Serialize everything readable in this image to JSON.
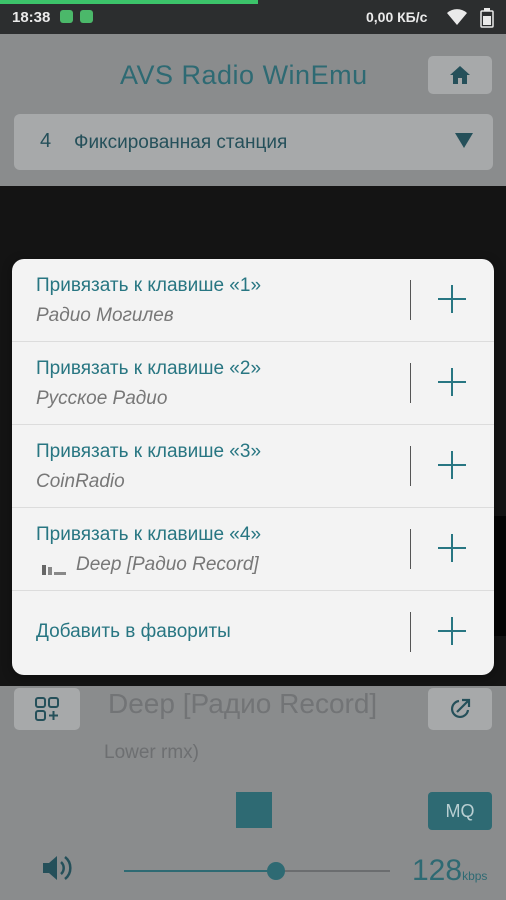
{
  "status_bar": {
    "time": "18:38",
    "network_speed": "0,00 КБ/с",
    "progress": 0.51
  },
  "app": {
    "title": "AVS Radio WinEmu",
    "station": {
      "number": "4",
      "name": "Фиксированная станция"
    },
    "now_playing": {
      "title": "Deep [Радио Record]",
      "subtitle": "Lower rmx)"
    },
    "mq_label": "MQ",
    "bitrate": "128",
    "bitrate_unit": "kbps",
    "volume": 0.57,
    "accent_color": "#2e6a73"
  },
  "dialog": {
    "items": [
      {
        "label": "Привязать к клавише «1»",
        "subtitle": "Радио Могилев"
      },
      {
        "label": "Привязать к клавише «2»",
        "subtitle": "Русское Радио"
      },
      {
        "label": "Привязать к клавише «3»",
        "subtitle": "CoinRadio"
      },
      {
        "label": "Привязать к клавише «4»",
        "subtitle": "Deep [Радио Record]"
      },
      {
        "label": "Добавить в фавориты"
      }
    ]
  }
}
